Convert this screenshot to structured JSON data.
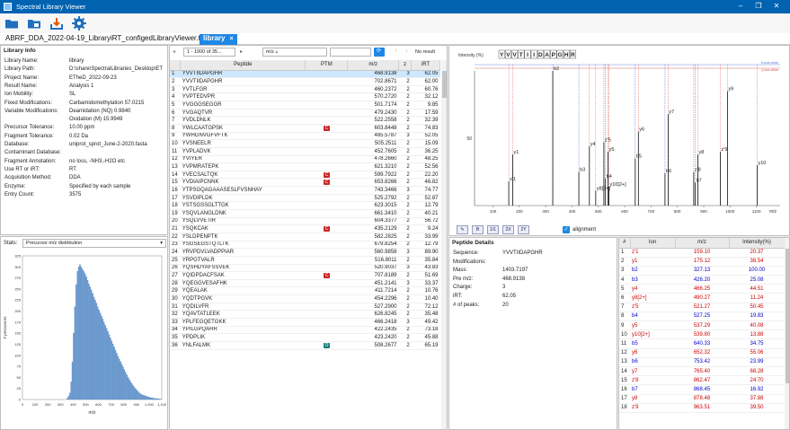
{
  "title": "Spectral Library Viewer",
  "window_controls": [
    "–",
    "❐",
    "✕"
  ],
  "toolbar": {
    "icons": [
      "open-folder-icon",
      "open-library-icon",
      "import-icon",
      "settings-icon"
    ]
  },
  "tabs": {
    "file_label": "ABRF_DDA_2022-04-19_LibraryiRT_configedLibraryViewer.tsv",
    "active_label": "library",
    "close": "×"
  },
  "library_info": {
    "title": "Library Info",
    "rows": [
      {
        "k": "Library Name:",
        "v": "library"
      },
      {
        "k": "Library Path:",
        "v": "D:\\share\\SpectralLibraries_Desktop\\ET"
      },
      {
        "k": "Project Name:",
        "v": "ETheD_2022-09-23"
      },
      {
        "k": "Result Name:",
        "v": "Analysis 1"
      },
      {
        "k": "Ion Mobility:",
        "v": "SL"
      },
      {
        "k": "Fixed Modifications:",
        "v": "Carbamidomethylation 57.0215"
      },
      {
        "k": "Variable Modifications:",
        "v": "Deamidation (NQ) 0.9840"
      },
      {
        "k": "",
        "v": "Oxidation (M) 15.9949"
      },
      {
        "k": "Precursor Tolerance:",
        "v": "10.00 ppm"
      },
      {
        "k": "Fragment Tolerance:",
        "v": "0.02 Da"
      },
      {
        "k": "Database:",
        "v": "uniprot_sprot_June-2-2020.fasta"
      },
      {
        "k": "Contaminant Database:",
        "v": ""
      },
      {
        "k": "Fragment Annotation:",
        "v": "no loss, -NH3,-H2O etc"
      },
      {
        "k": "Use RT or iRT:",
        "v": "RT"
      },
      {
        "k": "Acquisition Method:",
        "v": "DDA"
      },
      {
        "k": "Enzyme:",
        "v": "Specified by each sample"
      },
      {
        "k": "Entry Count:",
        "v": "3575"
      }
    ]
  },
  "stats": {
    "label": "Stats:",
    "select": "Precursor m/z distribution"
  },
  "histogram": {
    "type": "bar",
    "xlabel": "m/z",
    "ylabel": "# precursors",
    "xlim": [
      0,
      1100
    ],
    "ylim": [
      0,
      325
    ],
    "xticks": [
      "0",
      "100",
      "200",
      "300",
      "400",
      "500",
      "600",
      "700",
      "800",
      "900",
      "1,000",
      "1,100"
    ],
    "yticks": [
      "0",
      "25",
      "50",
      "75",
      "100",
      "125",
      "150",
      "175",
      "200",
      "225",
      "250",
      "275",
      "300",
      "325"
    ],
    "bin_width": 10,
    "bin_start": 350,
    "values": [
      3,
      8,
      15,
      40,
      85,
      150,
      210,
      260,
      290,
      300,
      305,
      300,
      295,
      290,
      285,
      278,
      270,
      262,
      255,
      248,
      240,
      232,
      225,
      218,
      210,
      203,
      196,
      189,
      182,
      175,
      168,
      161,
      154,
      147,
      140,
      133,
      126,
      119,
      112,
      105,
      98,
      92,
      86,
      80,
      74,
      68,
      62,
      56,
      50,
      45,
      40,
      36,
      32,
      28,
      24,
      21,
      18,
      15,
      13,
      11,
      10,
      9,
      8,
      7,
      6,
      5,
      4,
      4,
      3,
      3,
      2,
      2,
      2,
      1,
      1
    ]
  },
  "pager": {
    "range": "1 - 1000 of 35...",
    "mz_select": "m/z ▵",
    "no_result": "No result"
  },
  "table": {
    "headers": [
      "",
      "Peptide",
      "PTM",
      "m/z",
      "z",
      "iRT"
    ],
    "rows": [
      [
        "1",
        "YVVTIIDAPGHR",
        "",
        "468.9138",
        "3",
        "62.05"
      ],
      [
        "2",
        "YVVTIIDAPGHR",
        "",
        "702.8671",
        "2",
        "62.00"
      ],
      [
        "3",
        "YVTLFGR",
        "",
        "460.2372",
        "2",
        "60.76"
      ],
      [
        "4",
        "YVPTEDVPR",
        "",
        "570.2720",
        "2",
        "32.12"
      ],
      [
        "5",
        "YVGGGSEGGR",
        "",
        "501.7174",
        "2",
        "9.85"
      ],
      [
        "6",
        "YVGAQTVR",
        "",
        "479.2430",
        "2",
        "17.59"
      ],
      [
        "7",
        "YVDLDNLK",
        "",
        "522.2558",
        "2",
        "32.39"
      ],
      [
        "8",
        "YWLCAATGPSK",
        "C",
        "603.8448",
        "2",
        "74.83"
      ],
      [
        "9",
        "YWHGNVGFVFTK",
        "",
        "485.5787",
        "3",
        "52.05"
      ],
      [
        "10",
        "YVSNEELR",
        "",
        "505.2511",
        "2",
        "15.09"
      ],
      [
        "11",
        "YVPLADVK",
        "",
        "452.7605",
        "2",
        "36.25"
      ],
      [
        "12",
        "YVIYER",
        "",
        "478.2660",
        "2",
        "48.25"
      ],
      [
        "13",
        "YVPMRATEPK",
        "",
        "621.3210",
        "2",
        "52.56"
      ],
      [
        "14",
        "YVECSALTQK",
        "C",
        "599.7922",
        "2",
        "22.20"
      ],
      [
        "15",
        "YVDIAIPCNNK",
        "C",
        "653.8266",
        "2",
        "46.82"
      ],
      [
        "16",
        "YTPSGQAGAAASESLFVSNHAY",
        "",
        "743.3466",
        "3",
        "74.77"
      ],
      [
        "17",
        "YSVDIPLDK",
        "",
        "525.2792",
        "2",
        "52.87"
      ],
      [
        "18",
        "YSTSGSSGLTTGK",
        "",
        "623.3015",
        "2",
        "12.79"
      ],
      [
        "19",
        "YSQVLANGLDNK",
        "",
        "661.3410",
        "2",
        "40.21"
      ],
      [
        "20",
        "YSQLVVETIR",
        "",
        "604.3377",
        "2",
        "56.72"
      ],
      [
        "21",
        "YSQKCAK",
        "C",
        "435.2129",
        "2",
        "9.24"
      ],
      [
        "22",
        "YSLDPENPTK",
        "",
        "582.2825",
        "2",
        "33.99"
      ],
      [
        "23",
        "YSGSEGSTQTLTK",
        "",
        "679.8254",
        "2",
        "12.79"
      ],
      [
        "24",
        "YRVPDVLVADPPIAR",
        "",
        "560.9858",
        "3",
        "89.90"
      ],
      [
        "25",
        "YRPGTVALR",
        "",
        "516.8011",
        "2",
        "35.84"
      ],
      [
        "26",
        "YQSHDYAFSSVEK",
        "",
        "520.9037",
        "3",
        "43.83"
      ],
      [
        "27",
        "YQIDPDACFSAK",
        "C",
        "707.8189",
        "2",
        "51.69"
      ],
      [
        "28",
        "YQEGGVESAFHK",
        "",
        "451.2141",
        "3",
        "33.37"
      ],
      [
        "29",
        "YQEALAK",
        "",
        "411.7214",
        "2",
        "10.76"
      ],
      [
        "30",
        "YQDTPGVK",
        "",
        "454.2296",
        "2",
        "10.40"
      ],
      [
        "31",
        "YQDILVFR",
        "",
        "527.2900",
        "2",
        "72.12"
      ],
      [
        "32",
        "YQAVTATLEEK",
        "",
        "626.8245",
        "2",
        "35.48"
      ],
      [
        "33",
        "YPLFEGQETGKK",
        "",
        "466.2418",
        "3",
        "49.42"
      ],
      [
        "34",
        "YPILGPQAHR",
        "",
        "422.2435",
        "2",
        "73.18"
      ],
      [
        "35",
        "YPDPLIK",
        "",
        "423.2420",
        "2",
        "45.88"
      ],
      [
        "36",
        "YNLFALMK",
        "O",
        "508.2677",
        "2",
        "65.19"
      ]
    ]
  },
  "spectrum": {
    "ylabel": "Intensity (%)",
    "xlabel": "m/z",
    "xticks": [
      "100",
      "200",
      "300",
      "400",
      "500",
      "600",
      "700",
      "800",
      "900",
      "1000",
      "1100"
    ],
    "ytick": "50",
    "sequence": [
      "Y",
      "V",
      "V",
      "T",
      "I",
      "I",
      "D",
      "A",
      "P",
      "G",
      "H",
      "R"
    ],
    "legend_top": "b-ions  c/bse",
    "legend_bot": "y-ions  z/bse",
    "peaks": [
      {
        "label": "z'1",
        "mz": 160,
        "h": 18,
        "col": "#c00"
      },
      {
        "label": "y1",
        "mz": 175,
        "h": 38,
        "col": "#c00"
      },
      {
        "label": "b2",
        "mz": 327,
        "h": 100,
        "col": "#00c"
      },
      {
        "label": "b3",
        "mz": 426,
        "h": 25,
        "col": "#00c"
      },
      {
        "label": "y4",
        "mz": 466,
        "h": 44,
        "col": "#c00"
      },
      {
        "label": "y8[2+]",
        "mz": 490,
        "h": 11,
        "col": "#c00"
      },
      {
        "label": "z'5",
        "mz": 521,
        "h": 47,
        "col": "#c00"
      },
      {
        "label": "b4",
        "mz": 527,
        "h": 20,
        "col": "#00c"
      },
      {
        "label": "y5",
        "mz": 537,
        "h": 40,
        "col": "#c00"
      },
      {
        "label": "y10[2+]",
        "mz": 540,
        "h": 14,
        "col": "#c00"
      },
      {
        "label": "b5",
        "mz": 640,
        "h": 35,
        "col": "#00c"
      },
      {
        "label": "y6",
        "mz": 652,
        "h": 55,
        "col": "#c00"
      },
      {
        "label": "b6",
        "mz": 753,
        "h": 24,
        "col": "#00c"
      },
      {
        "label": "y7",
        "mz": 765,
        "h": 68,
        "col": "#c00"
      },
      {
        "label": "z'8",
        "mz": 862,
        "h": 25,
        "col": "#c00"
      },
      {
        "label": "b7",
        "mz": 868,
        "h": 17,
        "col": "#00c"
      },
      {
        "label": "y8",
        "mz": 878,
        "h": 38,
        "col": "#c00"
      },
      {
        "label": "z'9",
        "mz": 963,
        "h": 40,
        "col": "#c00"
      },
      {
        "label": "y9",
        "mz": 990,
        "h": 85,
        "col": "#c00"
      },
      {
        "label": "y10",
        "mz": 1103,
        "h": 30,
        "col": "#c00"
      }
    ]
  },
  "spec_controls": {
    "buttons": [
      "pin-icon",
      "B",
      "1/1",
      "2X",
      "2Y"
    ],
    "alignment_label": "alignment"
  },
  "peptide_details": {
    "title": "Peptide Details",
    "rows": [
      {
        "k": "Sequence:",
        "v": "YVVTIIDAPGHR"
      },
      {
        "k": "Modifications:",
        "v": ""
      },
      {
        "k": "Mass:",
        "v": "1403.7197"
      },
      {
        "k": "Pre m/z:",
        "v": "468.9138"
      },
      {
        "k": "Charge:",
        "v": "3"
      },
      {
        "k": "iRT:",
        "v": "62.05"
      },
      {
        "k": "# of peaks:",
        "v": "20"
      }
    ]
  },
  "ion_table": {
    "headers": [
      "#",
      "Ion",
      "m/z",
      "Intensity(%)"
    ],
    "rows": [
      [
        "1",
        "z'1",
        "159.10",
        "20.37",
        "#c00"
      ],
      [
        "2",
        "y1",
        "175.12",
        "38.54",
        "#c00"
      ],
      [
        "3",
        "b2",
        "327.13",
        "100.00",
        "#00c"
      ],
      [
        "4",
        "b3",
        "426.20",
        "25.08",
        "#00c"
      ],
      [
        "5",
        "y4",
        "466.25",
        "44.51",
        "#c00"
      ],
      [
        "6",
        "y8[2+]",
        "490.27",
        "11.24",
        "#c00"
      ],
      [
        "7",
        "z'5",
        "521.27",
        "50.45",
        "#c00"
      ],
      [
        "8",
        "b4",
        "527.25",
        "19.83",
        "#00c"
      ],
      [
        "9",
        "y5",
        "537.29",
        "40.08",
        "#c00"
      ],
      [
        "10",
        "y10[2+]",
        "539.80",
        "13.88",
        "#c00"
      ],
      [
        "11",
        "b5",
        "640.33",
        "34.75",
        "#00c"
      ],
      [
        "12",
        "y6",
        "652.32",
        "55.06",
        "#c00"
      ],
      [
        "13",
        "b6",
        "753.42",
        "23.99",
        "#00c"
      ],
      [
        "14",
        "y7",
        "765.40",
        "68.28",
        "#c00"
      ],
      [
        "15",
        "z'8",
        "862.47",
        "24.70",
        "#c00"
      ],
      [
        "16",
        "b7",
        "868.45",
        "16.92",
        "#00c"
      ],
      [
        "17",
        "y8",
        "878.48",
        "37.88",
        "#c00"
      ],
      [
        "18",
        "z'9",
        "963.51",
        "39.50",
        "#c00"
      ]
    ]
  }
}
